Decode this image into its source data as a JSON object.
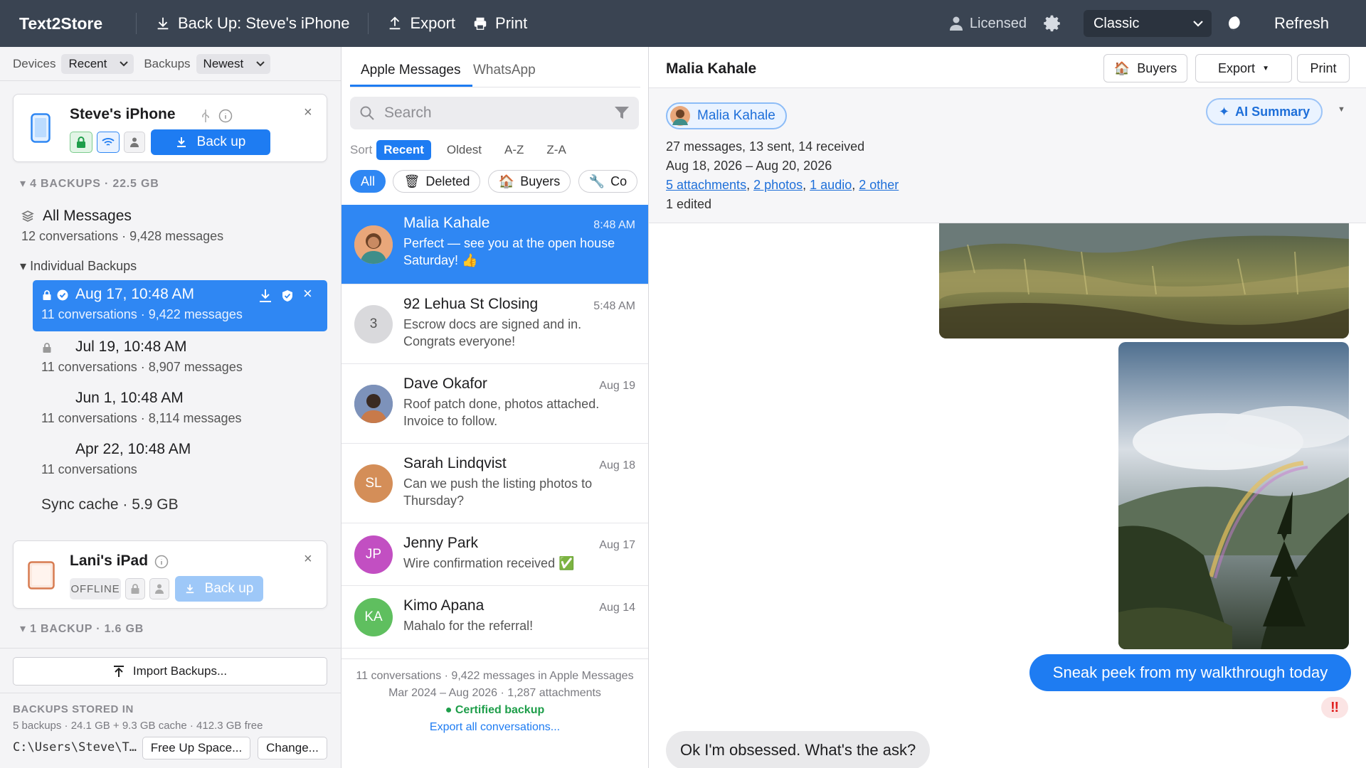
{
  "app": {
    "title": "Text2Store"
  },
  "toolbar": {
    "backup_label": "Back Up: Steve's iPhone",
    "export_label": "Export",
    "print_label": "Print",
    "licensed_label": "Licensed",
    "theme_value": "Classic",
    "refresh_label": "Refresh"
  },
  "left": {
    "devices_label": "Devices",
    "devices_sort": "Recent",
    "backups_label": "Backups",
    "backups_sort": "Newest",
    "device1": {
      "name": "Steve's iPhone",
      "backup_button": "Back up",
      "section": "4 BACKUPS · 22.5 GB",
      "all_title": "All Messages",
      "all_sub": "12 conversations · 9,428 messages",
      "individual_label": "Individual Backups",
      "backups": [
        {
          "title": "Aug 17, 10:48 AM",
          "sub": "11 conversations · 9,422 messages"
        },
        {
          "title": "Jul 19, 10:48 AM",
          "sub": "11 conversations · 8,907 messages"
        },
        {
          "title": "Jun 1, 10:48 AM",
          "sub": "11 conversations · 8,114 messages"
        },
        {
          "title": "Apr 22, 10:48 AM",
          "sub": "11 conversations"
        }
      ],
      "sync_cache": "Sync cache · 5.9 GB"
    },
    "device2": {
      "name": "Lani's iPad",
      "status": "OFFLINE",
      "backup_button": "Back up",
      "section": "1 BACKUP · 1.6 GB"
    },
    "import_button": "Import Backups...",
    "stored_head": "BACKUPS STORED IN",
    "stored_sub": "5 backups · 24.1 GB + 9.3 GB cache · 412.3 GB free",
    "path": "C:\\Users\\Steve\\T…",
    "free_up_button": "Free Up Space...",
    "change_button": "Change..."
  },
  "middle": {
    "tabs": [
      "Apple Messages",
      "WhatsApp"
    ],
    "search_placeholder": "Search",
    "sort_label": "Sort",
    "sort_options": [
      "Recent",
      "Oldest",
      "A-Z",
      "Z-A"
    ],
    "filters": [
      "All",
      "Deleted",
      "Buyers",
      "Co"
    ],
    "conversations": [
      {
        "name": "Malia Kahale",
        "time": "8:48 AM",
        "preview": "Perfect — see you at the open house Saturday! 👍"
      },
      {
        "name": "92 Lehua St Closing",
        "time": "5:48 AM",
        "preview": "Escrow docs are signed and in. Congrats everyone!",
        "initials": "3"
      },
      {
        "name": "Dave Okafor",
        "time": "Aug 19",
        "preview": "Roof patch done, photos attached. Invoice to follow."
      },
      {
        "name": "Sarah Lindqvist",
        "time": "Aug 18",
        "preview": "Can we push the listing photos to Thursday?",
        "initials": "SL"
      },
      {
        "name": "Jenny Park",
        "time": "Aug 17",
        "preview": "Wire confirmation received ✅",
        "initials": "JP"
      },
      {
        "name": "Kimo Apana",
        "time": "Aug 14",
        "preview": "Mahalo for the referral!",
        "initials": "KA"
      }
    ],
    "footer_line1": "11 conversations · 9,422 messages in Apple Messages",
    "footer_line2": "Mar 2024 – Aug 2026 · 1,287 attachments",
    "certified": "Certified backup",
    "export_all": "Export all conversations..."
  },
  "right": {
    "contact_name": "Malia Kahale",
    "buyers_button": "Buyers",
    "export_button": "Export",
    "print_button": "Print",
    "ai_summary": "AI Summary",
    "stats_line": "27 messages, 13 sent, 14 received",
    "date_range": "Aug 18, 2026 – Aug 20, 2026",
    "links": [
      "5 attachments",
      "2 photos",
      "1 audio",
      "2 other"
    ],
    "edited": "1 edited",
    "sent_message": "Sneak peek from my walkthrough today",
    "reaction": "‼",
    "received_message": "Ok I'm obsessed. What's the ask?"
  },
  "colors": {
    "accent": "#1e7cf2",
    "topbar": "#3a4452",
    "selected": "#2f87f3"
  }
}
